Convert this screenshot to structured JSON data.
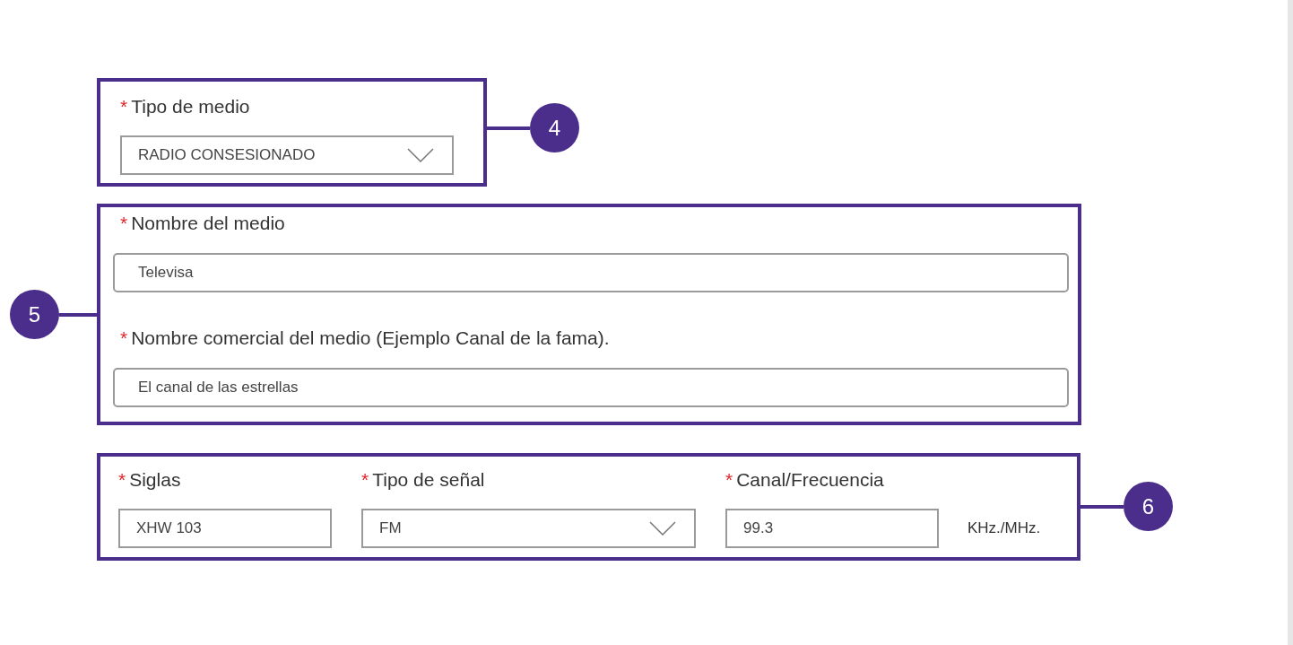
{
  "sections": [
    {
      "callout": "4",
      "kind": "single",
      "fields": [
        {
          "mark": "*",
          "label": "Tipo de medio",
          "kind": "select",
          "value": "RADIO CONSESIONADO"
        }
      ]
    },
    {
      "callout": "5",
      "kind": "stack",
      "fields": [
        {
          "mark": "*",
          "label": "Nombre del medio",
          "kind": "text",
          "value": "Televisa"
        },
        {
          "mark": "*",
          "label": "Nombre comercial del medio (Ejemplo Canal de la fama).",
          "kind": "text",
          "value": "El canal de las estrellas"
        }
      ]
    },
    {
      "callout": "6",
      "kind": "row",
      "fields": [
        {
          "mark": "*",
          "label": "Siglas",
          "kind": "text",
          "value": "XHW 103"
        },
        {
          "mark": "*",
          "label": "Tipo de señal",
          "kind": "select",
          "value": "FM"
        },
        {
          "mark": "*",
          "label": "Canal/Frecuencia",
          "kind": "text",
          "value": "99.3",
          "unit": "KHz./MHz."
        }
      ]
    }
  ]
}
